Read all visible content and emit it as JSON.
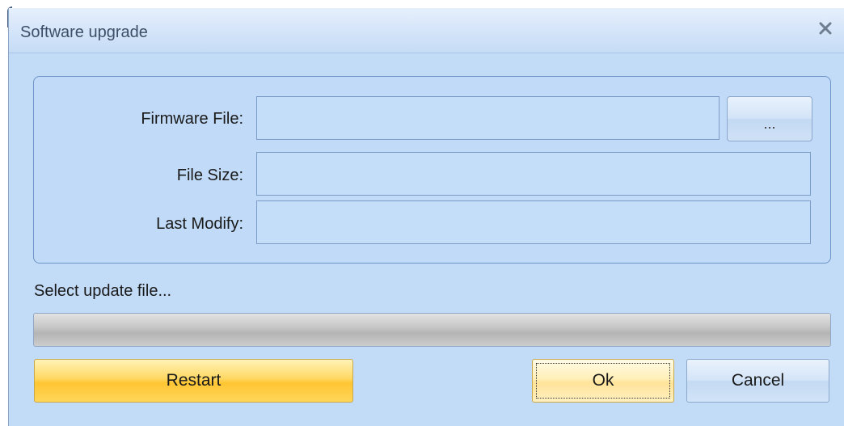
{
  "window": {
    "title": "Software upgrade",
    "close_icon": "close-icon"
  },
  "form": {
    "firmware_file": {
      "label": "Firmware File:",
      "value": ""
    },
    "browse_button": {
      "label": "..."
    },
    "file_size": {
      "label": "File Size:",
      "value": ""
    },
    "last_modify": {
      "label": "Last Modify:",
      "value": ""
    }
  },
  "status": {
    "text": "Select update file...",
    "progress_fraction": 0
  },
  "buttons": {
    "restart": "Restart",
    "ok": "Ok",
    "cancel": "Cancel"
  },
  "colors": {
    "window_bg": "#c2dbf7",
    "restart_button": "#ffd862",
    "focused_button": "#ffefb8",
    "progress_track": "#c8c8c8"
  }
}
